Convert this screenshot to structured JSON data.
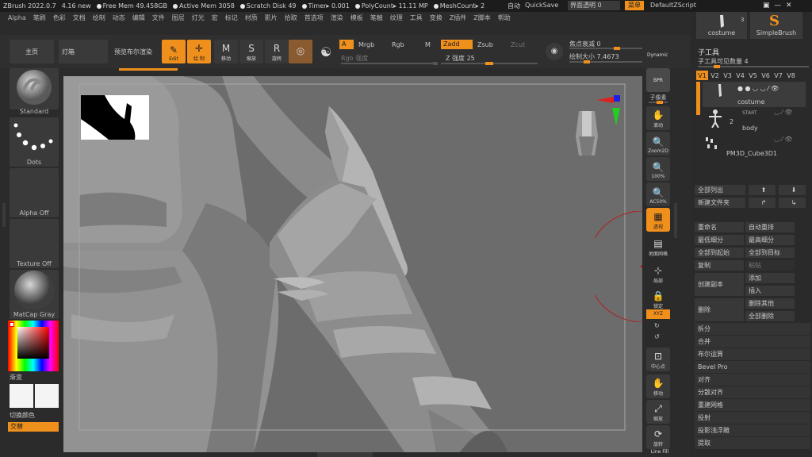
{
  "topbar": {
    "app": "ZBrush 2022.0.7",
    "version": "4.16 new",
    "free_mem": "Free Mem 49.458GB",
    "active_mem": "Active Mem 3058",
    "scratch": "Scratch Disk 49",
    "timer": "Timer▸ 0.001",
    "polycount": "PolyCount▸ 11.11 MP",
    "meshcount": "MeshCount▸ 2",
    "auto": "自动",
    "quicksave": "QuickSave",
    "transparency": "界面透明 0",
    "menu": "菜单",
    "script": "DefaultZScript"
  },
  "menubar": [
    "Alpha",
    "笔刷",
    "色彩",
    "文档",
    "绘制",
    "动态",
    "编辑",
    "文件",
    "图层",
    "灯光",
    "宏",
    "标记",
    "材质",
    "影片",
    "拾取",
    "首选项",
    "渲染",
    "模板",
    "笔触",
    "纹理",
    "工具",
    "变换",
    "Z插件",
    "Z脚本",
    "帮助"
  ],
  "toolbar": {
    "home": "主页",
    "lightbox": "灯箱",
    "bool_preview": "预览布尔渲染",
    "edit": "Edit",
    "draw": "绘 制",
    "move": "移动",
    "scale": "缩放",
    "rotate": "旋转",
    "a": "A",
    "mrgb": "Mrgb",
    "rgb": "Rgb",
    "m": "M",
    "rgb_intensity": "Rgb 强度",
    "zadd": "Zadd",
    "zsub": "Zsub",
    "zcut": "Zcut",
    "z_intensity": "Z 强度 25",
    "focal": "焦点衰减 0",
    "draw_size": "绘制大小 7.4673",
    "dynamic": "Dynamic"
  },
  "left": {
    "brush": "Standard",
    "stroke": "Dots",
    "alpha": "Alpha Off",
    "texture": "Texture Off",
    "material": "MatCap Gray",
    "gradient": "渐变",
    "switch_color": "切换颜色",
    "alternate": "交替"
  },
  "right_tools": {
    "bpr": "BPR",
    "subpixel": "子像素",
    "scroll": "滚动",
    "zoom2d": "Zoom2D",
    "p100": "100%",
    "ac50": "AC50%",
    "perspective": "透视",
    "floor": "地面网格",
    "local": "局部",
    "lock": "锁定",
    "xyz": "XYZ",
    "center": "中心点",
    "move": "移动",
    "scale": "缩放",
    "rotate": "旋转",
    "linefill": "Line Fill"
  },
  "rightpanel": {
    "costume": "costume",
    "simplebrush": "SimpleBrush",
    "num3": "3",
    "subtool": "子工具",
    "visible_count": "子工具可见数量 4",
    "versions": [
      "V1",
      "V2",
      "V3",
      "V4",
      "V5",
      "V6",
      "V7",
      "V8"
    ],
    "items": [
      {
        "name": "costume"
      },
      {
        "name": "body",
        "num": "2"
      },
      {
        "name": "PM3D_Cube3D1"
      }
    ],
    "start_label": "START",
    "list_all": "全部列出",
    "new_folder": "新建文件夹",
    "rename": "重命名",
    "auto_reorder": "自动重排",
    "lowest_sub": "最低细分",
    "highest_sub": "最高细分",
    "all_to_start": "全部到起始",
    "all_to_target": "全部到目标",
    "copy": "复制",
    "paste": "粘贴",
    "duplicate": "创建副本",
    "append": "添加",
    "insert": "插入",
    "delete": "删除",
    "delete_other": "删除其他",
    "delete_all": "全部删除",
    "split": "拆分",
    "merge": "合并",
    "boolean": "布尔运算",
    "bevelpro": "Bevel Pro",
    "align": "对齐",
    "distribute": "分散对齐",
    "remesh": "重建网格",
    "project": "投射",
    "project_shallow": "投影浅浮雕",
    "extract": "提取"
  },
  "colors": {
    "accent": "#f0901c",
    "bg": "#2b2b2b",
    "canvas": "#6e6e6e"
  }
}
